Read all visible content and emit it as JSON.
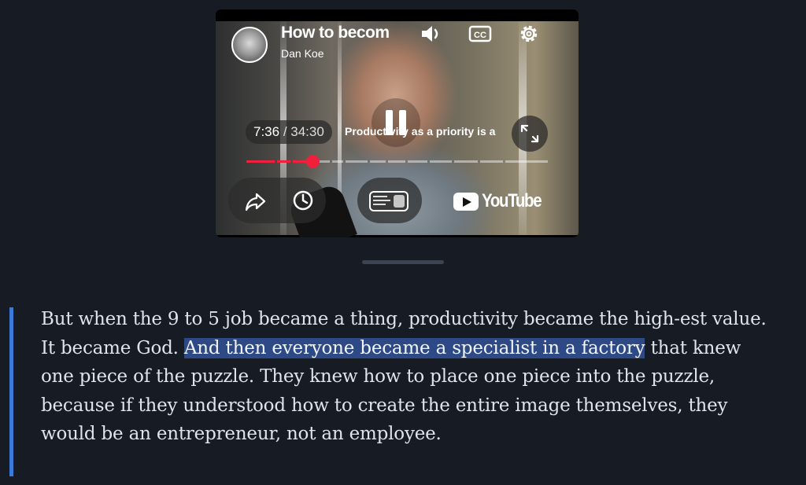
{
  "player": {
    "title": "How to becom",
    "channel": "Dan Koe",
    "current_time": "7:36",
    "separator": " / ",
    "duration": "34:30",
    "chapter": "Productivity as a priority is a",
    "progress_fraction": 0.22,
    "brand": "YouTube",
    "icons": {
      "volume": "volume-icon",
      "captions": "captions-icon",
      "settings": "gear-icon",
      "pause": "pause-icon",
      "fullscreen": "fullscreen-icon",
      "share": "share-icon",
      "watch_later": "clock-icon"
    },
    "accent_color": "#f0203c"
  },
  "article": {
    "text_before": "But when the 9 to 5 job became a thing, productivity became the high-est value. It became God. ",
    "highlighted": "And then everyone became a specialist in a factory",
    "text_after": " that knew one piece of the puzzle. They knew how to place one piece into the puzzle, because if they understood how to create the entire image themselves, they would be an entrepreneur, not an employee.",
    "highlight_color": "#2e4a86",
    "quote_bar_color": "#3b7ad9"
  }
}
